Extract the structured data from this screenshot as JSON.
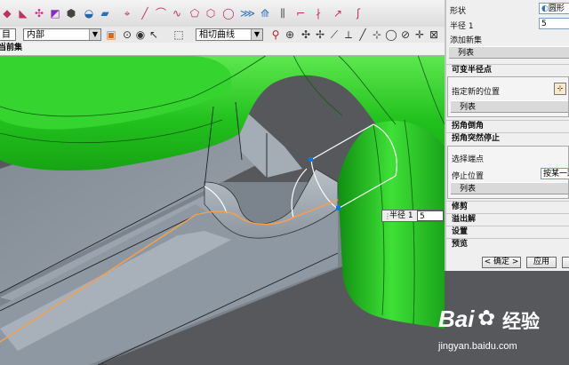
{
  "toolbar": {
    "combo1_value": "目部",
    "combo2_value": "内部",
    "combo3_value": "相切曲线"
  },
  "tab": {
    "label": "当前集"
  },
  "panel": {
    "shape_label": "形状",
    "shape_value": "圆形",
    "radius_label": "半径 1",
    "radius_value": "5",
    "add_new_set": "添加新集",
    "list1": "列表",
    "variable_radius": "可变半径点",
    "specify_new_location": "指定新的位置",
    "list2": "列表",
    "corner_setback": "拐角倒角",
    "corner_stop": "拐角突然停止",
    "select_endpoint": "选择端点",
    "stop_location_label": "停止位置",
    "stop_location_value": "按某一距",
    "list3": "列表",
    "trim": "修剪",
    "overflow": "溢出解",
    "settings": "设置",
    "preview": "预览",
    "ok_button": "< 确定 >",
    "apply_button": "应用"
  },
  "viewport_label": {
    "radius_label": "半径 1",
    "radius_value": "5"
  },
  "watermark": {
    "brand": "Bai",
    "brand_suffix": "经验",
    "url": "jingyan.baidu.com"
  },
  "colors": {
    "green_surface": "#22c11d",
    "gray_body": "#9aa2ab",
    "orange_curve": "#f0a050"
  }
}
